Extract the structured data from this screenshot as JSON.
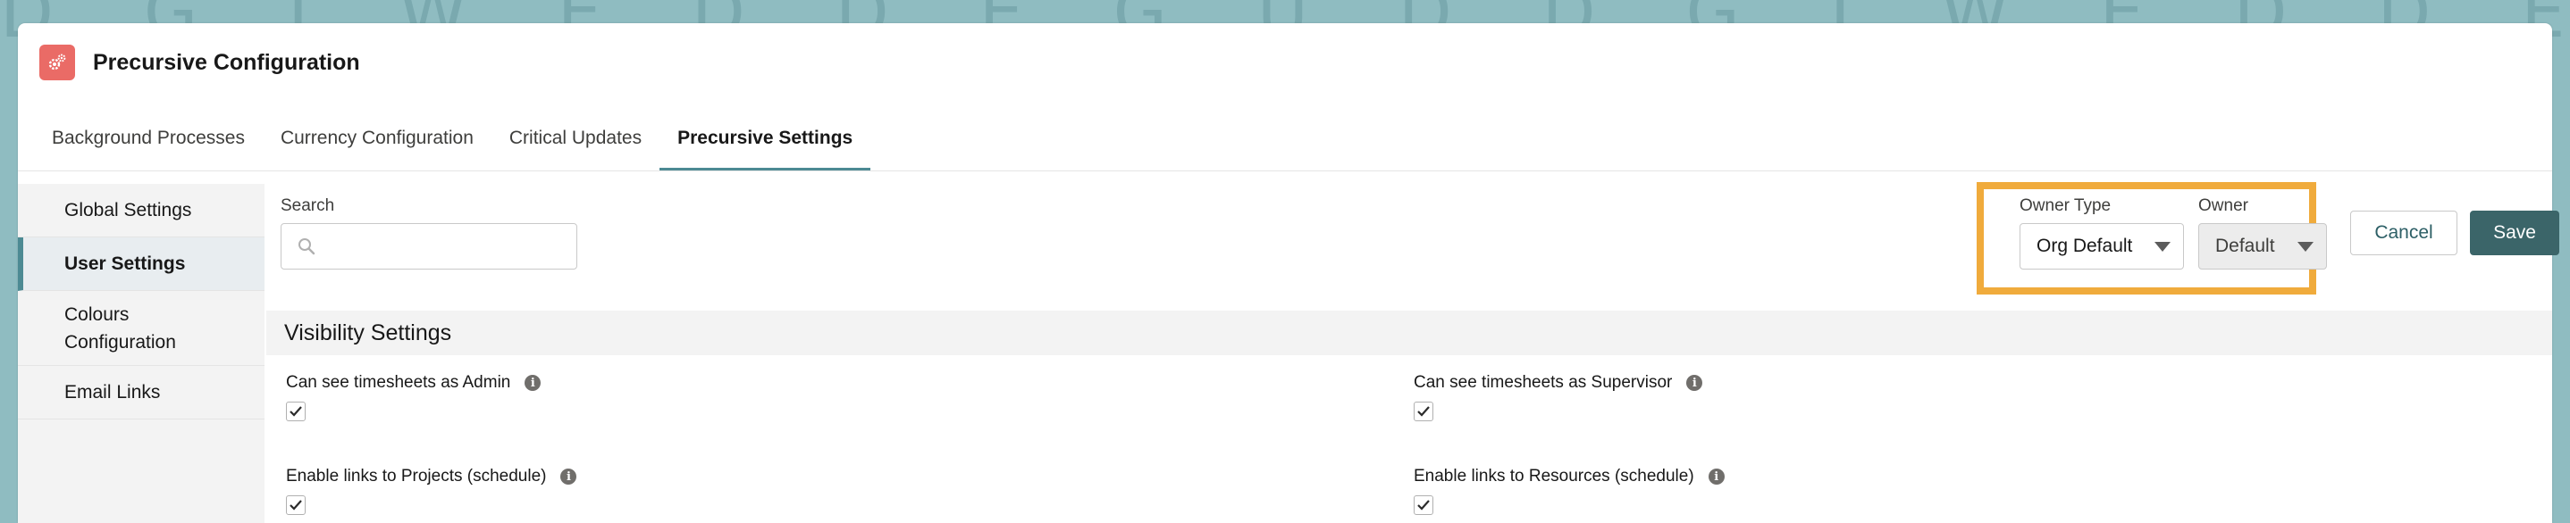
{
  "app": {
    "title": "Precursive Configuration",
    "icon": "settings-gears-icon",
    "accent": "#4c8a93",
    "highlight": "#f0ab3c"
  },
  "tabs": [
    {
      "label": "Background Processes",
      "active": false
    },
    {
      "label": "Currency Configuration",
      "active": false
    },
    {
      "label": "Critical Updates",
      "active": false
    },
    {
      "label": "Precursive Settings",
      "active": true
    }
  ],
  "sidebar": {
    "items": [
      {
        "label": "Global Settings",
        "active": false
      },
      {
        "label": "User Settings",
        "active": true
      },
      {
        "label": "Colours Configuration",
        "active": false
      },
      {
        "label": "Email Links",
        "active": false
      }
    ]
  },
  "search": {
    "label": "Search",
    "value": "",
    "placeholder": ""
  },
  "owner_type": {
    "label": "Owner Type",
    "value": "Org Default"
  },
  "owner": {
    "label": "Owner",
    "value": "Default"
  },
  "actions": {
    "cancel_label": "Cancel",
    "save_label": "Save"
  },
  "visibility": {
    "title": "Visibility Settings",
    "settings": [
      {
        "label": "Can see timesheets as Admin",
        "checked": true
      },
      {
        "label": "Can see timesheets as Supervisor",
        "checked": true
      },
      {
        "label": "Enable links to Projects (schedule)",
        "checked": true
      },
      {
        "label": "Enable links to Resources (schedule)",
        "checked": true
      }
    ]
  }
}
